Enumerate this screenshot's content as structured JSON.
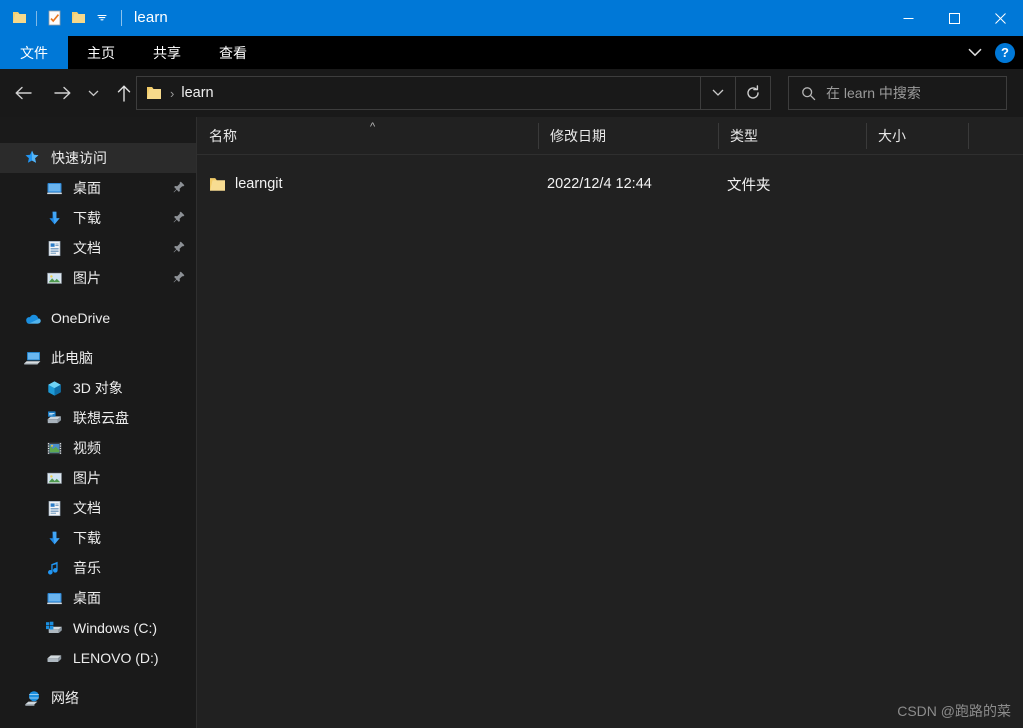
{
  "window": {
    "title": "learn",
    "quick_access_toolbar": [
      {
        "name": "folder-icon",
        "label": "文件夹"
      },
      {
        "name": "properties-icon",
        "label": "属性"
      },
      {
        "name": "new-folder-icon",
        "label": "新建文件夹"
      },
      {
        "name": "customize-dropdown-icon",
        "label": "自定义快速访问工具栏"
      }
    ],
    "controls": {
      "minimize": "最小化",
      "maximize": "最大化",
      "close": "关闭"
    },
    "accent_color": "#0078d7",
    "titlebar_color": "#0078d7",
    "background_color": "#202020"
  },
  "ribbon": {
    "tabs": [
      {
        "label": "文件",
        "selected": true
      },
      {
        "label": "主页",
        "selected": false
      },
      {
        "label": "共享",
        "selected": false
      },
      {
        "label": "查看",
        "selected": false
      }
    ],
    "collapse_label": "展开功能区",
    "help_label": "?"
  },
  "navigation": {
    "back": "后退",
    "forward": "前进",
    "recent": "最近浏览的位置",
    "up": "向上"
  },
  "address": {
    "crumbs": [
      "learn"
    ],
    "separator": "›",
    "dropdown_label": "以前的位置",
    "refresh_label": "刷新"
  },
  "search": {
    "placeholder": "在 learn 中搜索",
    "icon": "search-icon"
  },
  "sidebar": {
    "groups": [
      {
        "header": {
          "label": "快速访问",
          "icon": "star-pin-icon",
          "selected": true
        },
        "items": [
          {
            "label": "桌面",
            "icon": "desktop-icon",
            "pinned": true
          },
          {
            "label": "下载",
            "icon": "download-icon",
            "pinned": true
          },
          {
            "label": "文档",
            "icon": "document-icon",
            "pinned": true
          },
          {
            "label": "图片",
            "icon": "pictures-icon",
            "pinned": true
          }
        ]
      },
      {
        "header": {
          "label": "OneDrive",
          "icon": "onedrive-cloud-icon",
          "selected": false
        },
        "items": []
      },
      {
        "header": {
          "label": "此电脑",
          "icon": "this-pc-icon",
          "selected": false
        },
        "items": [
          {
            "label": "3D 对象",
            "icon": "3d-objects-icon",
            "pinned": false
          },
          {
            "label": "联想云盘",
            "icon": "lenovo-cloud-icon",
            "pinned": false
          },
          {
            "label": "视频",
            "icon": "videos-icon",
            "pinned": false
          },
          {
            "label": "图片",
            "icon": "pictures-icon",
            "pinned": false
          },
          {
            "label": "文档",
            "icon": "document-icon",
            "pinned": false
          },
          {
            "label": "下载",
            "icon": "download-icon",
            "pinned": false
          },
          {
            "label": "音乐",
            "icon": "music-icon",
            "pinned": false
          },
          {
            "label": "桌面",
            "icon": "desktop-icon",
            "pinned": false
          },
          {
            "label": "Windows (C:)",
            "icon": "windows-drive-icon",
            "pinned": false
          },
          {
            "label": "LENOVO (D:)",
            "icon": "drive-icon",
            "pinned": false
          }
        ]
      },
      {
        "header": {
          "label": "网络",
          "icon": "network-icon",
          "selected": false
        },
        "items": []
      }
    ]
  },
  "file_list": {
    "columns": [
      {
        "label": "名称",
        "sorted": "asc"
      },
      {
        "label": "修改日期",
        "sorted": ""
      },
      {
        "label": "类型",
        "sorted": ""
      },
      {
        "label": "大小",
        "sorted": ""
      }
    ],
    "rows": [
      {
        "name": "learngit",
        "date_modified": "2022/12/4 12:44",
        "type": "文件夹",
        "size": "",
        "icon": "folder-icon"
      }
    ]
  },
  "watermark": {
    "text": "CSDN @跑路的菜"
  }
}
